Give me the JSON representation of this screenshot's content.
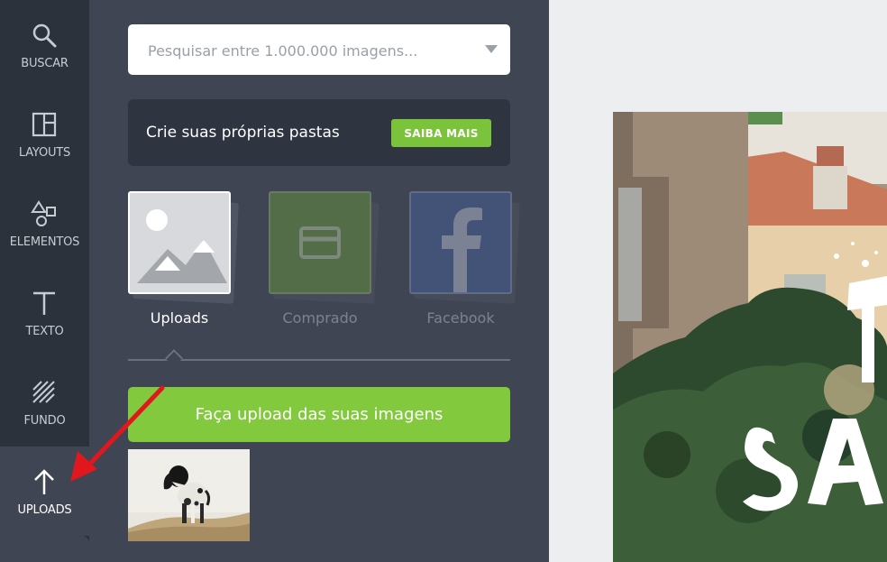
{
  "sidebar": {
    "items": [
      {
        "label": "BUSCAR",
        "icon": "search-icon"
      },
      {
        "label": "LAYOUTS",
        "icon": "layouts-icon"
      },
      {
        "label": "ELEMENTOS",
        "icon": "elements-icon"
      },
      {
        "label": "TEXTO",
        "icon": "text-icon"
      },
      {
        "label": "FUNDO",
        "icon": "background-icon"
      },
      {
        "label": "UPLOADS",
        "icon": "upload-arrow-icon",
        "active": true
      }
    ]
  },
  "search": {
    "placeholder": "Pesquisar entre 1.000.000 imagens..."
  },
  "promo": {
    "text": "Crie suas próprias pastas",
    "button_label": "SAIBA MAIS"
  },
  "sources": [
    {
      "label": "Uploads",
      "icon": "image-placeholder-icon",
      "active": true
    },
    {
      "label": "Comprado",
      "icon": "credit-card-icon",
      "active": false
    },
    {
      "label": "Facebook",
      "icon": "facebook-icon",
      "active": false
    }
  ],
  "upload_button": {
    "label": "Faça upload das suas imagens"
  },
  "colors": {
    "rail_bg": "#2c323b",
    "panel_bg": "#3f4552",
    "accent_green": "#7cc33c",
    "canvas_bg": "#eceef0",
    "annotation_red": "#e0181e"
  }
}
